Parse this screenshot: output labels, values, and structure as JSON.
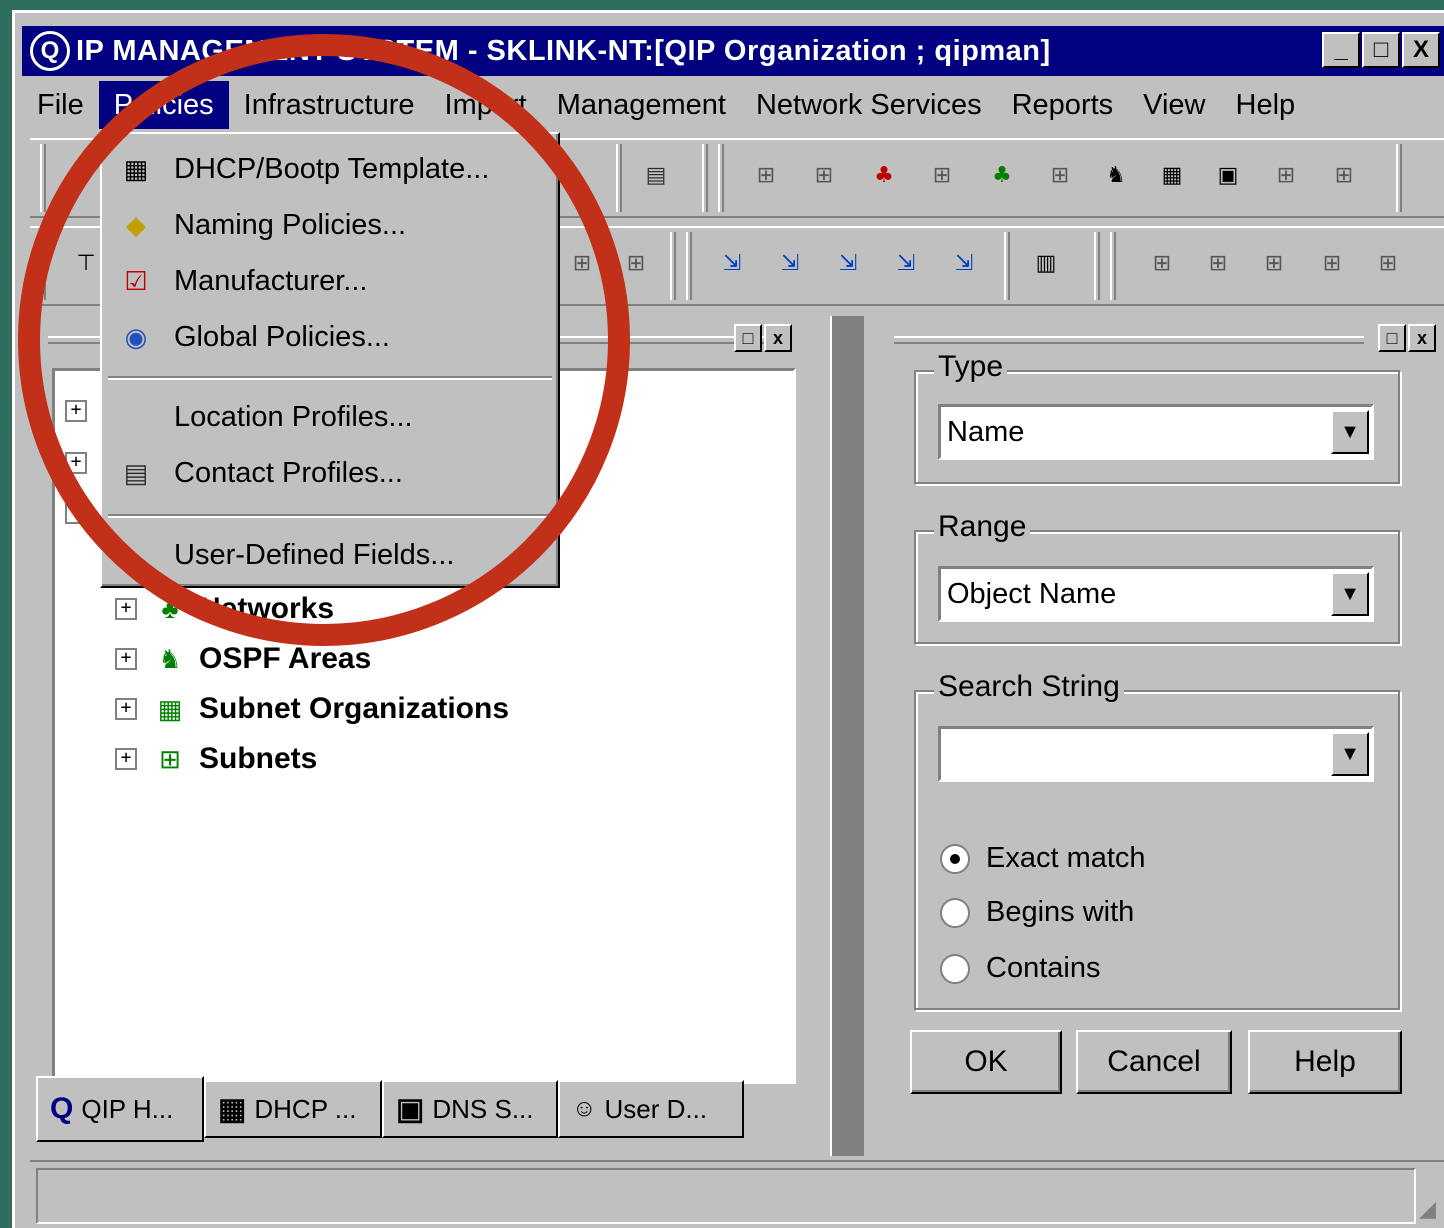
{
  "window": {
    "title": "IP MANAGEMENT SYSTEM - SKLINK-NT:[QIP Organization ; qipman]",
    "app_icon": "Q",
    "controls": [
      "_",
      "□",
      "X"
    ]
  },
  "menubar": {
    "items": [
      "File",
      "Policies",
      "Infrastructure",
      "Import",
      "Management",
      "Network Services",
      "Reports",
      "View",
      "Help"
    ]
  },
  "policies_menu": {
    "items": [
      {
        "label": "DHCP/Bootp Template...",
        "icon": "dhcp-template-icon"
      },
      {
        "label": "Naming Policies...",
        "icon": "naming-tag-icon"
      },
      {
        "label": "Manufacturer...",
        "icon": "manufacturer-check-icon"
      },
      {
        "label": "Global Policies...",
        "icon": "globe-policy-icon"
      },
      {
        "label": "Location Profiles...",
        "icon": ""
      },
      {
        "label": "Contact Profiles...",
        "icon": "contact-profile-icon"
      },
      {
        "label": "User-Defined Fields...",
        "icon": ""
      }
    ]
  },
  "tree": {
    "items": [
      {
        "label": "Networks"
      },
      {
        "label": "OSPF Areas"
      },
      {
        "label": "Subnet Organizations"
      },
      {
        "label": "Subnets"
      }
    ]
  },
  "left_pane_controls": [
    "□",
    "x"
  ],
  "bottom_tabs": [
    {
      "label": "QIP H...",
      "icon": "Q"
    },
    {
      "label": "DHCP ...",
      "icon": "▦"
    },
    {
      "label": "DNS S...",
      "icon": "▣"
    },
    {
      "label": "User D...",
      "icon": "☺"
    }
  ],
  "search": {
    "type_label": "Type",
    "type_value": "Name",
    "range_label": "Range",
    "range_value": "Object Name",
    "search_label": "Search String",
    "search_value": "",
    "options": [
      {
        "label": "Exact match",
        "selected": true
      },
      {
        "label": "Begins with",
        "selected": false
      },
      {
        "label": "Contains",
        "selected": false
      }
    ],
    "ok_label": "OK",
    "cancel_label": "Cancel",
    "help_label": "Help"
  },
  "colors": {
    "title_bar": "#000080",
    "highlight": "#c2301a",
    "face": "#c0c0c0"
  }
}
